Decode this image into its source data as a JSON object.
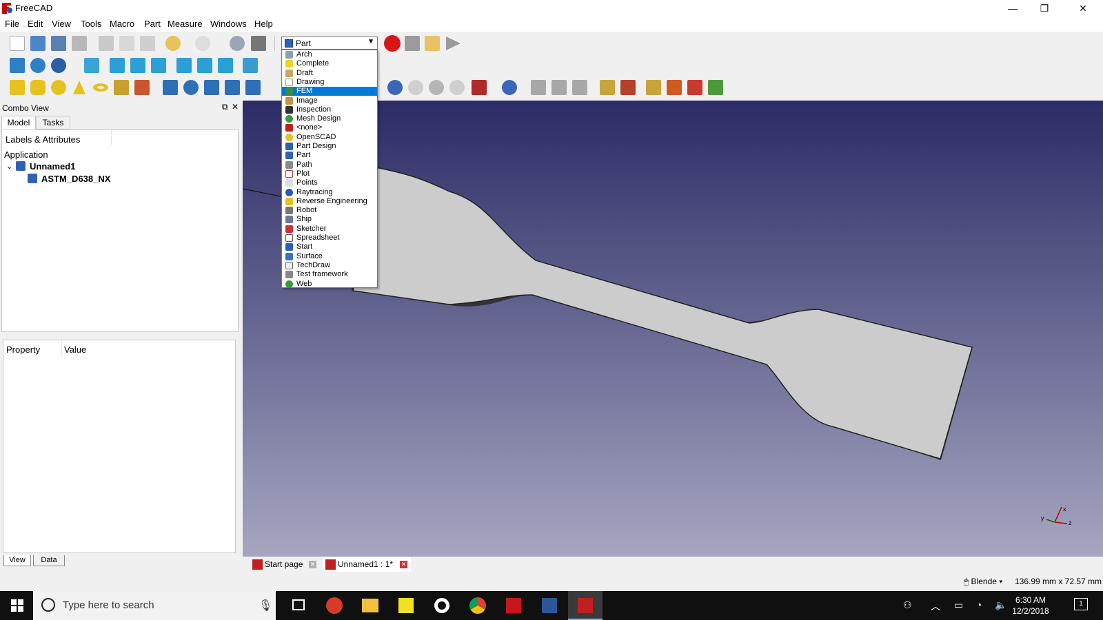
{
  "window": {
    "title": "FreeCAD",
    "minimize": "—",
    "restore": "❐",
    "close": "✕"
  },
  "menu": [
    "File",
    "Edit",
    "View",
    "Tools",
    "Macro",
    "Part",
    "Measure",
    "Windows",
    "Help"
  ],
  "workbench_selector": {
    "selected": "Part",
    "highlighted": "FEM",
    "options": [
      "Arch",
      "Complete",
      "Draft",
      "Drawing",
      "FEM",
      "Image",
      "Inspection",
      "Mesh Design",
      "<none>",
      "OpenSCAD",
      "Part Design",
      "Part",
      "Path",
      "Plot",
      "Points",
      "Raytracing",
      "Reverse Engineering",
      "Robot",
      "Ship",
      "Sketcher",
      "Spreadsheet",
      "Start",
      "Surface",
      "TechDraw",
      "Test framework",
      "Web"
    ]
  },
  "combo_view": {
    "title": "Combo View",
    "tabs": [
      "Model",
      "Tasks"
    ],
    "tree_header": "Labels & Attributes",
    "section": "Application",
    "document": "Unnamed1",
    "object": "ASTM_D638_NX",
    "property_header": "Property",
    "value_header": "Value",
    "bottom_tabs": [
      "View",
      "Data"
    ]
  },
  "doc_tabs": [
    {
      "label": "Start page",
      "active": false
    },
    {
      "label": "Unnamed1 : 1*",
      "active": true
    }
  ],
  "status": {
    "navigation": "Blende",
    "dimensions": "136.99 mm x 72.57 mm"
  },
  "taskbar": {
    "search_placeholder": "Type here to search",
    "time": "6:30 AM",
    "date": "12/2/2018",
    "notifications": "1"
  },
  "colors": {
    "selection": "#0078d7",
    "viewport_top": "#2c2c66",
    "viewport_bottom": "#a6a6c0",
    "part_face": "#cccccc"
  }
}
